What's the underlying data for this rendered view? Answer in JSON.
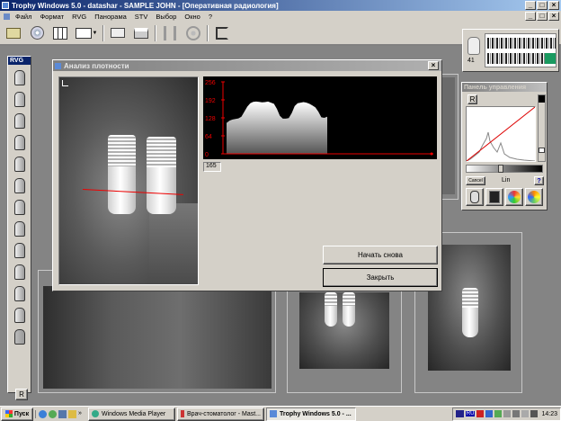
{
  "app": {
    "title": "Trophy Windows 5.0 - datashar - SAMPLE JOHN - [Оперативная радиология]"
  },
  "menu": [
    "Файл",
    "Формат",
    "RVG",
    "Панорама",
    "STV",
    "Выбор",
    "Окно",
    "?"
  ],
  "toolbar": {
    "buttons": [
      "folder-open-icon",
      "disc-icon",
      "layout-icon",
      "screen-icon",
      "mail-icon",
      "print-icon",
      "tool-icon",
      "wheel-icon",
      "exit-icon"
    ]
  },
  "left_panel": {
    "label": "RVG",
    "tooth_count": 13,
    "bottom_label": "R"
  },
  "density_dialog": {
    "title": "Анализ плотности",
    "graph_y_ticks": [
      "256",
      "192",
      "128",
      "64",
      "0"
    ],
    "readout": "165",
    "profile": [
      110,
      118,
      122,
      124,
      126,
      132,
      150,
      168,
      180,
      185,
      186,
      185,
      183,
      184,
      186,
      182,
      178,
      160,
      135,
      125,
      125,
      127,
      145,
      170,
      180,
      182,
      184,
      182,
      178,
      172,
      165,
      150,
      130,
      128,
      132
    ],
    "restart_button": "Начать снова",
    "close_button": "Закрыть"
  },
  "control_panel": {
    "title": "Панель управления",
    "option_label": "R",
    "mode_label": "Lin",
    "left_button": "Cancel",
    "right_button": "?"
  },
  "tooth_chart": {
    "number": "41"
  },
  "taskbar": {
    "start": "Пуск",
    "tasks": [
      "Windows Media Player",
      "Врач-стоматолог - Mast...",
      "Trophy Windows 5.0 - ..."
    ],
    "lang": "RU",
    "time": "14:23"
  }
}
